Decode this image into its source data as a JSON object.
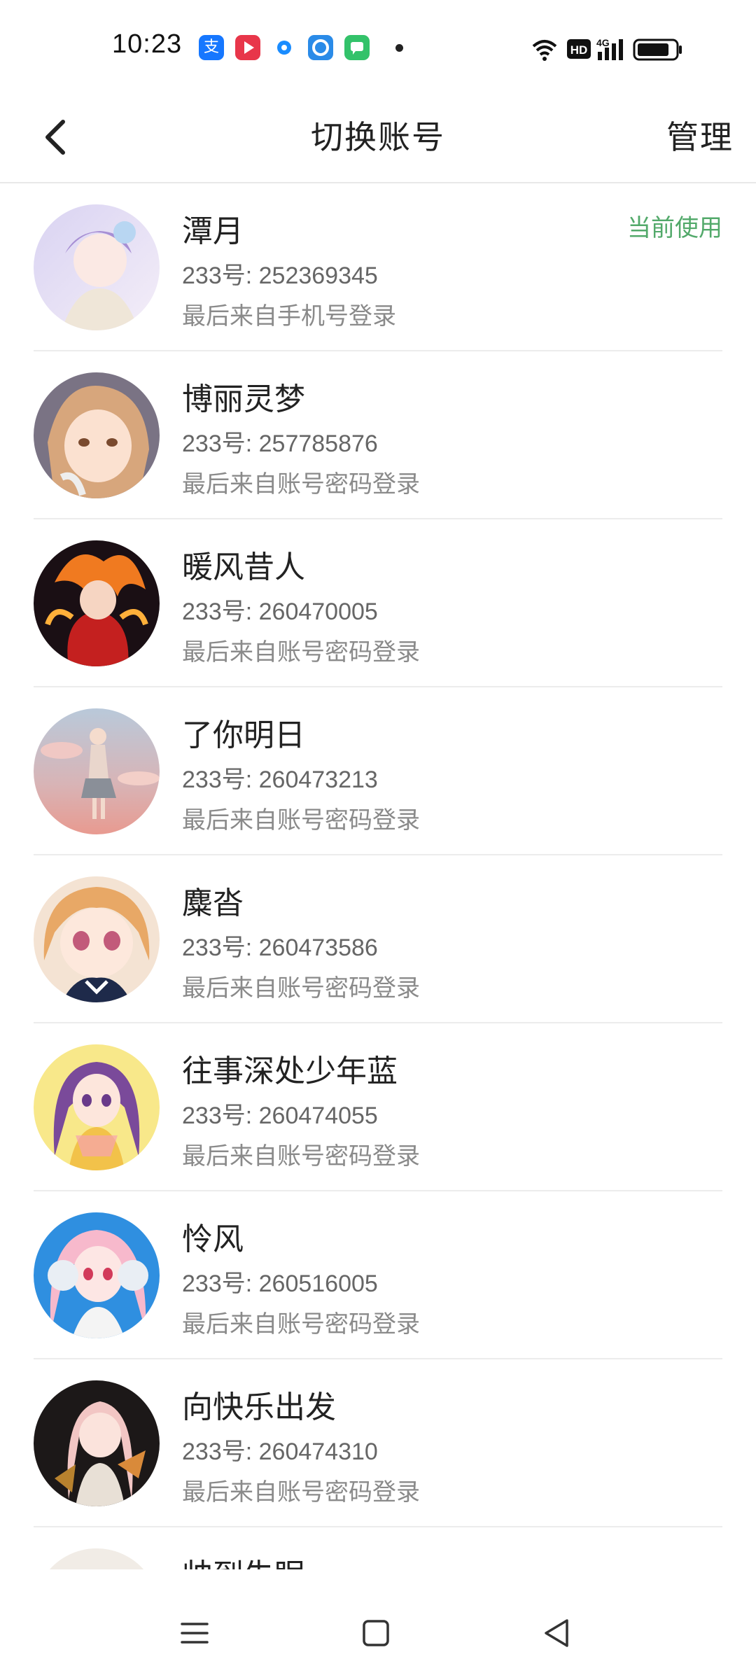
{
  "status_bar": {
    "time": "10:23",
    "hd_label": "HD",
    "network_label": "4G"
  },
  "header": {
    "title": "切换账号",
    "manage_label": "管理"
  },
  "accounts": [
    {
      "name": "潭月",
      "id": "233号: 252369345",
      "login": "最后来自手机号登录",
      "badge": "当前使用"
    },
    {
      "name": "博丽灵梦",
      "id": "233号: 257785876",
      "login": "最后来自账号密码登录"
    },
    {
      "name": "暖风昔人",
      "id": "233号: 260470005",
      "login": "最后来自账号密码登录"
    },
    {
      "name": "了你明日",
      "id": "233号: 260473213",
      "login": "最后来自账号密码登录"
    },
    {
      "name": "麋沓",
      "id": "233号: 260473586",
      "login": "最后来自账号密码登录"
    },
    {
      "name": "往事深处少年蓝",
      "id": "233号: 260474055",
      "login": "最后来自账号密码登录"
    },
    {
      "name": "怜风",
      "id": "233号: 260516005",
      "login": "最后来自账号密码登录"
    },
    {
      "name": "向快乐出发",
      "id": "233号: 260474310",
      "login": "最后来自账号密码登录"
    },
    {
      "name": "帅到失眠",
      "id": "",
      "login": ""
    }
  ],
  "colors": {
    "accent_green": "#52a96a",
    "divider": "#ececec"
  }
}
